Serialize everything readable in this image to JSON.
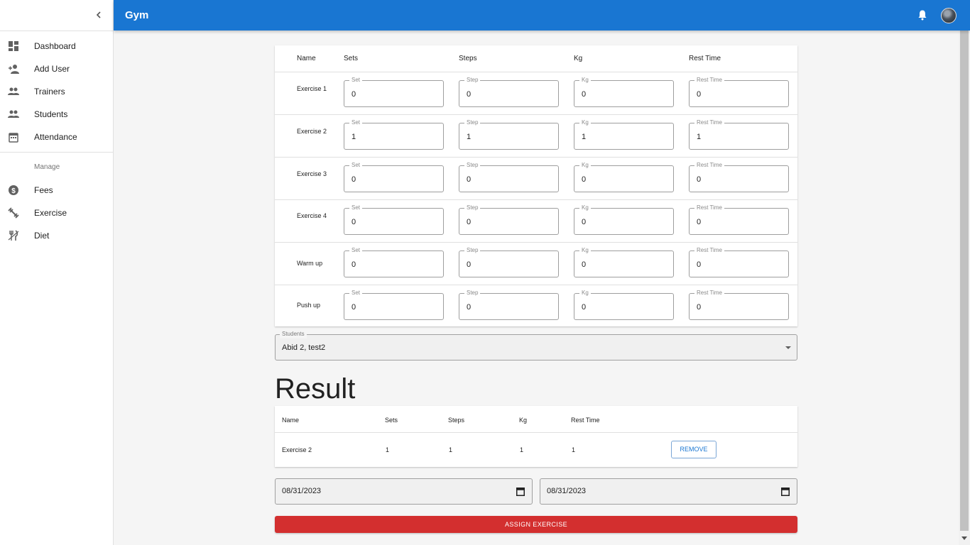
{
  "app": {
    "title": "Gym"
  },
  "sidebar": {
    "items": [
      {
        "label": "Dashboard",
        "icon": "dashboard-icon"
      },
      {
        "label": "Add User",
        "icon": "add-user-icon"
      },
      {
        "label": "Trainers",
        "icon": "people-icon"
      },
      {
        "label": "Students",
        "icon": "people-icon"
      },
      {
        "label": "Attendance",
        "icon": "calendar-icon"
      }
    ],
    "section_title": "Manage",
    "manage_items": [
      {
        "label": "Fees",
        "icon": "dollar-icon"
      },
      {
        "label": "Exercise",
        "icon": "fitness-icon"
      },
      {
        "label": "Diet",
        "icon": "restaurant-icon"
      }
    ]
  },
  "exercise_table": {
    "headers": {
      "name": "Name",
      "sets": "Sets",
      "steps": "Steps",
      "kg": "Kg",
      "rest": "Rest Time"
    },
    "field_labels": {
      "set": "Set",
      "step": "Step",
      "kg": "Kg",
      "rest": "Rest Time"
    },
    "rows": [
      {
        "name": "Exercise 1",
        "set": "0",
        "step": "0",
        "kg": "0",
        "rest": "0"
      },
      {
        "name": "Exercise 2",
        "set": "1",
        "step": "1",
        "kg": "1",
        "rest": "1"
      },
      {
        "name": "Exercise 3",
        "set": "0",
        "step": "0",
        "kg": "0",
        "rest": "0"
      },
      {
        "name": "Exercise 4",
        "set": "0",
        "step": "0",
        "kg": "0",
        "rest": "0"
      },
      {
        "name": "Warm up",
        "set": "0",
        "step": "0",
        "kg": "0",
        "rest": "0"
      },
      {
        "name": "Push up",
        "set": "0",
        "step": "0",
        "kg": "0",
        "rest": "0"
      }
    ]
  },
  "students": {
    "label": "Students",
    "value": "Abid 2, test2"
  },
  "result": {
    "title": "Result",
    "headers": {
      "name": "Name",
      "sets": "Sets",
      "steps": "Steps",
      "kg": "Kg",
      "rest": "Rest Time"
    },
    "rows": [
      {
        "name": "Exercise 2",
        "sets": "1",
        "steps": "1",
        "kg": "1",
        "rest": "1",
        "action": "REMOVE"
      }
    ]
  },
  "dates": {
    "start": "08/31/2023",
    "end": "08/31/2023"
  },
  "assign_button": "ASSIGN EXERCISE",
  "colors": {
    "primary": "#1976d2",
    "danger": "#d32f2f"
  }
}
